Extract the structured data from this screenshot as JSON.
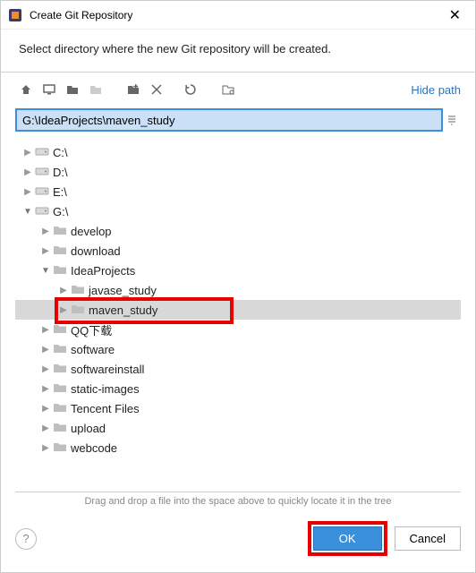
{
  "titlebar": {
    "title": "Create Git Repository"
  },
  "instructions": "Select directory where the new Git repository will be created.",
  "toolbar": {
    "hidepath_label": "Hide path"
  },
  "pathfield": {
    "value": "G:\\IdeaProjects\\maven_study"
  },
  "tree": [
    {
      "depth": 0,
      "arrow": "collapsed",
      "icon": "drive",
      "label": "C:\\"
    },
    {
      "depth": 0,
      "arrow": "collapsed",
      "icon": "drive",
      "label": "D:\\"
    },
    {
      "depth": 0,
      "arrow": "collapsed",
      "icon": "drive",
      "label": "E:\\"
    },
    {
      "depth": 0,
      "arrow": "expanded",
      "icon": "drive",
      "label": "G:\\"
    },
    {
      "depth": 1,
      "arrow": "collapsed",
      "icon": "folder",
      "label": "develop"
    },
    {
      "depth": 1,
      "arrow": "collapsed",
      "icon": "folder",
      "label": "download"
    },
    {
      "depth": 1,
      "arrow": "expanded",
      "icon": "folder",
      "label": "IdeaProjects"
    },
    {
      "depth": 2,
      "arrow": "collapsed",
      "icon": "folder",
      "label": "javase_study"
    },
    {
      "depth": 2,
      "arrow": "collapsed",
      "icon": "folder",
      "label": "maven_study",
      "selected": true,
      "highlight": true
    },
    {
      "depth": 1,
      "arrow": "collapsed",
      "icon": "folder",
      "label": "QQ下载"
    },
    {
      "depth": 1,
      "arrow": "collapsed",
      "icon": "folder",
      "label": "software"
    },
    {
      "depth": 1,
      "arrow": "collapsed",
      "icon": "folder",
      "label": "softwareinstall"
    },
    {
      "depth": 1,
      "arrow": "collapsed",
      "icon": "folder",
      "label": "static-images"
    },
    {
      "depth": 1,
      "arrow": "collapsed",
      "icon": "folder",
      "label": "Tencent Files"
    },
    {
      "depth": 1,
      "arrow": "collapsed",
      "icon": "folder",
      "label": "upload"
    },
    {
      "depth": 1,
      "arrow": "collapsed",
      "icon": "folder",
      "label": "webcode"
    }
  ],
  "hint": "Drag and drop a file into the space above to quickly locate it in the tree",
  "buttons": {
    "ok": "OK",
    "cancel": "Cancel"
  }
}
